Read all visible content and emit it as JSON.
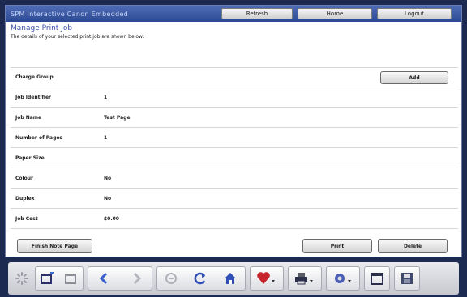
{
  "window": {
    "title": "SPM Interactive Canon Embedded"
  },
  "toolbar": {
    "refresh_label": "Refresh",
    "home_label": "Home",
    "logout_label": "Logout"
  },
  "header": {
    "title": "Manage Print Job",
    "subtitle": "The details of your selected print job are shown below."
  },
  "fields": [
    {
      "label": "Charge Group",
      "value": ""
    },
    {
      "label": "Job Identifier",
      "value": "1"
    },
    {
      "label": "Job Name",
      "value": "Test Page"
    },
    {
      "label": "Number of Pages",
      "value": "1"
    },
    {
      "label": "Paper Size",
      "value": ""
    },
    {
      "label": "Colour",
      "value": "No"
    },
    {
      "label": "Duplex",
      "value": "No"
    },
    {
      "label": "Job Cost",
      "value": "$0.00"
    }
  ],
  "buttons": {
    "add_label": "Add",
    "finish_label": "Finish Note Page",
    "print_label": "Print",
    "delete_label": "Delete"
  },
  "taskbar": {
    "icons": [
      "spinner-icon",
      "window-add-icon",
      "window-icon",
      "back-arrow-icon",
      "forward-arrow-icon",
      "stop-icon",
      "reload-icon",
      "home-icon",
      "heart-icon",
      "printer-icon",
      "gear-icon",
      "calendar-icon",
      "save-icon"
    ]
  },
  "colors": {
    "title_bar": "#2c4a93",
    "accent": "#3a4fa8",
    "frame": "#1c2a52"
  }
}
